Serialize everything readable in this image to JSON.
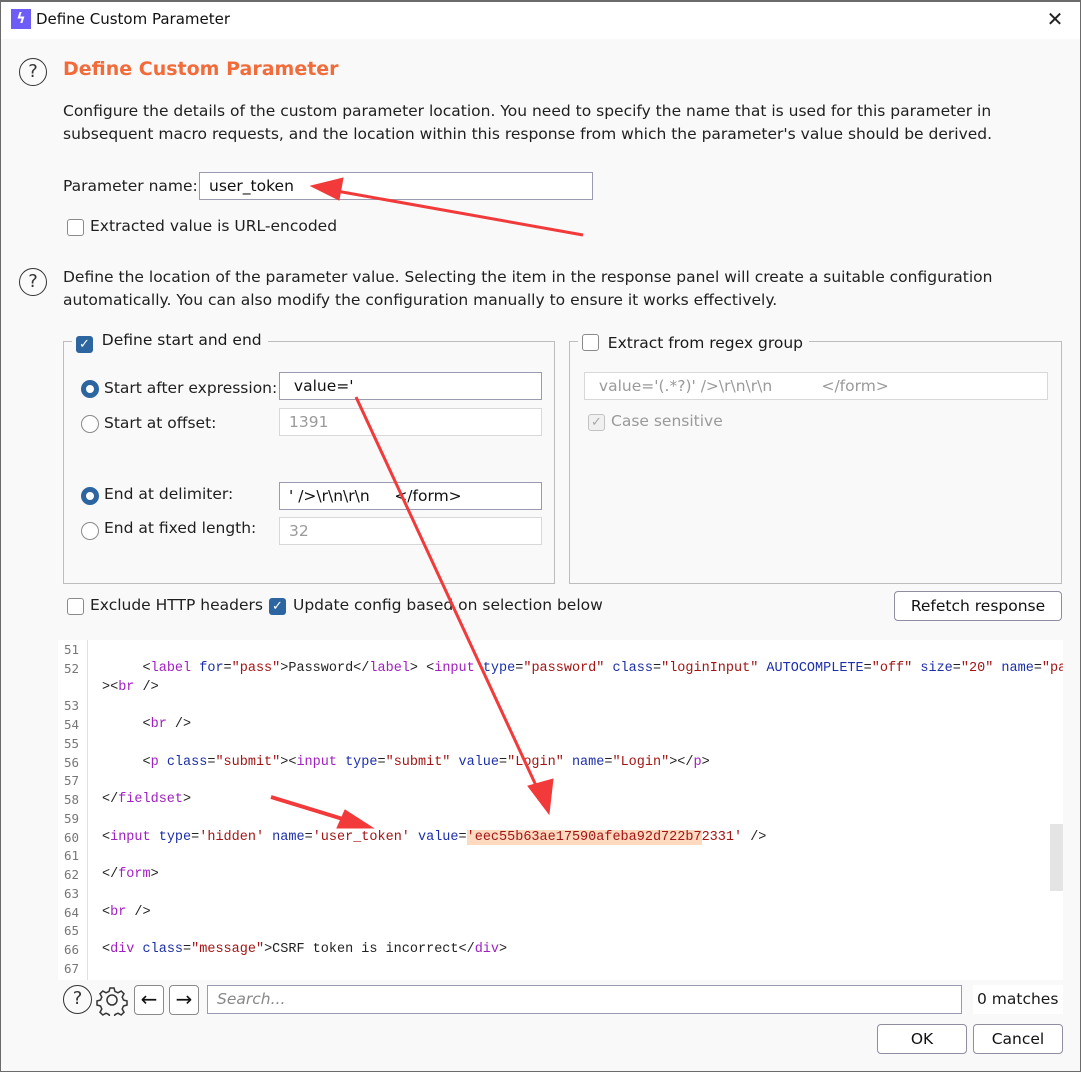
{
  "window": {
    "title": "Define Custom Parameter",
    "app_icon": "lightning-bolt-icon",
    "close_icon": "close-icon"
  },
  "header": {
    "title": "Define Custom Parameter",
    "description": "Configure the details of the custom parameter location. You need to specify the name that is used for this parameter in subsequent macro requests, and the location within this response from which the parameter's value should be derived."
  },
  "parameter": {
    "name_label": "Parameter name:",
    "name_value": "user_token",
    "url_encoded_label": "Extracted value is URL-encoded",
    "url_encoded_checked": false
  },
  "location": {
    "description": "Define the location of the parameter value. Selecting the item in the response panel will create a suitable configuration automatically. You can also modify the configuration manually to ensure it works effectively."
  },
  "start_end": {
    "legend": "Define start and end",
    "checked": true,
    "start_after_label": "Start after expression:",
    "start_after_value": " value='",
    "start_after_selected": true,
    "start_offset_label": "Start at offset:",
    "start_offset_value": "1391",
    "end_delimiter_label": "End at delimiter:",
    "end_delimiter_value": "' />\\r\\n\\r\\n     </form>",
    "end_delimiter_selected": true,
    "end_fixed_label": "End at fixed length:",
    "end_fixed_value": "32"
  },
  "regex": {
    "legend": "Extract from regex group",
    "checked": false,
    "value": " value='(.*?)' />\\r\\n\\r\\n          </form>",
    "case_sensitive_label": "Case sensitive",
    "case_sensitive_checked": true
  },
  "options": {
    "exclude_headers_label": "Exclude HTTP headers",
    "exclude_headers_checked": false,
    "update_config_label": "Update config based on selection below",
    "update_config_checked": true,
    "refetch_label": "Refetch response"
  },
  "response": {
    "lines": [
      {
        "n": "51",
        "segments": []
      },
      {
        "n": "52",
        "segments": [
          {
            "c": "p",
            "t": "     "
          },
          {
            "c": "p",
            "t": "<"
          },
          {
            "c": "t",
            "t": "label"
          },
          {
            "c": "a",
            "t": " for"
          },
          {
            "c": "p",
            "t": "="
          },
          {
            "c": "s",
            "t": "\"pass\""
          },
          {
            "c": "p",
            "t": ">Password</"
          },
          {
            "c": "t",
            "t": "label"
          },
          {
            "c": "p",
            "t": "> <"
          },
          {
            "c": "t",
            "t": "input"
          },
          {
            "c": "a",
            "t": " type"
          },
          {
            "c": "p",
            "t": "="
          },
          {
            "c": "s",
            "t": "\"password\""
          },
          {
            "c": "a",
            "t": " class"
          },
          {
            "c": "p",
            "t": "="
          },
          {
            "c": "s",
            "t": "\"loginInput\""
          },
          {
            "c": "a",
            "t": " AUTOCOMPLETE"
          },
          {
            "c": "p",
            "t": "="
          },
          {
            "c": "s",
            "t": "\"off\""
          },
          {
            "c": "a",
            "t": " size"
          },
          {
            "c": "p",
            "t": "="
          },
          {
            "c": "s",
            "t": "\"20\""
          },
          {
            "c": "a",
            "t": " name"
          },
          {
            "c": "p",
            "t": "="
          },
          {
            "c": "s",
            "t": "\"pass\""
          }
        ]
      },
      {
        "n": "",
        "segments": [
          {
            "c": "p",
            "t": "><"
          },
          {
            "c": "t",
            "t": "br"
          },
          {
            "c": "p",
            "t": " />"
          }
        ]
      },
      {
        "n": "53",
        "segments": []
      },
      {
        "n": "54",
        "segments": [
          {
            "c": "p",
            "t": "     <"
          },
          {
            "c": "t",
            "t": "br"
          },
          {
            "c": "p",
            "t": " />"
          }
        ]
      },
      {
        "n": "55",
        "segments": []
      },
      {
        "n": "56",
        "segments": [
          {
            "c": "p",
            "t": "     <"
          },
          {
            "c": "t",
            "t": "p"
          },
          {
            "c": "a",
            "t": " class"
          },
          {
            "c": "p",
            "t": "="
          },
          {
            "c": "s",
            "t": "\"submit\""
          },
          {
            "c": "p",
            "t": "><"
          },
          {
            "c": "t",
            "t": "input"
          },
          {
            "c": "a",
            "t": " type"
          },
          {
            "c": "p",
            "t": "="
          },
          {
            "c": "s",
            "t": "\"submit\""
          },
          {
            "c": "a",
            "t": " value"
          },
          {
            "c": "p",
            "t": "="
          },
          {
            "c": "s",
            "t": "\"Login\""
          },
          {
            "c": "a",
            "t": " name"
          },
          {
            "c": "p",
            "t": "="
          },
          {
            "c": "s",
            "t": "\"Login\""
          },
          {
            "c": "p",
            "t": "></"
          },
          {
            "c": "t",
            "t": "p"
          },
          {
            "c": "p",
            "t": ">"
          }
        ]
      },
      {
        "n": "57",
        "segments": []
      },
      {
        "n": "58",
        "segments": [
          {
            "c": "p",
            "t": "</"
          },
          {
            "c": "t",
            "t": "fieldset"
          },
          {
            "c": "p",
            "t": ">"
          }
        ]
      },
      {
        "n": "59",
        "segments": []
      },
      {
        "n": "60",
        "segments": [
          {
            "c": "p",
            "t": "<"
          },
          {
            "c": "t",
            "t": "input"
          },
          {
            "c": "a",
            "t": " type"
          },
          {
            "c": "p",
            "t": "="
          },
          {
            "c": "s",
            "t": "'hidden'"
          },
          {
            "c": "a",
            "t": " name"
          },
          {
            "c": "p",
            "t": "="
          },
          {
            "c": "s",
            "t": "'user_token'"
          },
          {
            "c": "a",
            "t": " value"
          },
          {
            "c": "p",
            "t": "="
          },
          {
            "c": "s hl",
            "t": "'eec55b63ae17590afeba92d722b7"
          },
          {
            "c": "s",
            "t": "2331'"
          },
          {
            "c": "p",
            "t": " />"
          }
        ]
      },
      {
        "n": "61",
        "segments": []
      },
      {
        "n": "62",
        "segments": [
          {
            "c": "p",
            "t": "</"
          },
          {
            "c": "t",
            "t": "form"
          },
          {
            "c": "p",
            "t": ">"
          }
        ]
      },
      {
        "n": "63",
        "segments": []
      },
      {
        "n": "64",
        "segments": [
          {
            "c": "p",
            "t": "<"
          },
          {
            "c": "t",
            "t": "br"
          },
          {
            "c": "p",
            "t": " />"
          }
        ]
      },
      {
        "n": "65",
        "segments": []
      },
      {
        "n": "66",
        "segments": [
          {
            "c": "p",
            "t": "<"
          },
          {
            "c": "t",
            "t": "div"
          },
          {
            "c": "a",
            "t": " class"
          },
          {
            "c": "p",
            "t": "="
          },
          {
            "c": "s",
            "t": "\"message\""
          },
          {
            "c": "p",
            "t": ">CSRF token is incorrect</"
          },
          {
            "c": "t",
            "t": "div"
          },
          {
            "c": "p",
            "t": ">"
          }
        ]
      },
      {
        "n": "67",
        "segments": []
      }
    ],
    "highlighted_value": "eec55b63ae17590afeba92d722b72331"
  },
  "search": {
    "help_icon": "help-icon",
    "settings_icon": "gear-icon",
    "prev_icon": "arrow-left-icon",
    "next_icon": "arrow-right-icon",
    "placeholder": "Search...",
    "value": "",
    "matches": "0 matches"
  },
  "footer": {
    "ok_label": "OK",
    "cancel_label": "Cancel"
  },
  "annotations": {
    "arrow_color": "#f23a3a"
  },
  "colors": {
    "title_accent": "#f26b3a",
    "checkbox_accent": "#2c65a0",
    "highlight": "#fcd9bf"
  }
}
